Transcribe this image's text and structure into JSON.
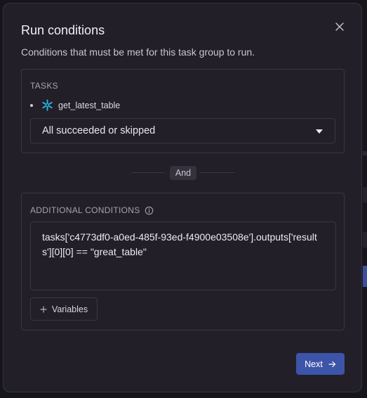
{
  "modal": {
    "title": "Run conditions",
    "subtitle": "Conditions that must be met for this task group to run."
  },
  "tasks_section": {
    "label": "TASKS",
    "items": [
      {
        "name": "get_latest_table",
        "icon": "snowflake-icon"
      }
    ],
    "condition_select": {
      "value": "All succeeded or skipped"
    }
  },
  "divider": {
    "label": "And"
  },
  "additional_section": {
    "label": "ADDITIONAL CONDITIONS",
    "info_icon": "info-icon",
    "expression": "tasks['c4773df0-a0ed-485f-93ed-f4900e03508e'].outputs['results'][0][0] == \"great_table\"",
    "variables_button": "Variables"
  },
  "footer": {
    "next_label": "Next"
  },
  "colors": {
    "accent": "#3d55a8",
    "snowflake": "#29b5e8",
    "modal_bg": "#221f29",
    "border": "#3a3744"
  }
}
